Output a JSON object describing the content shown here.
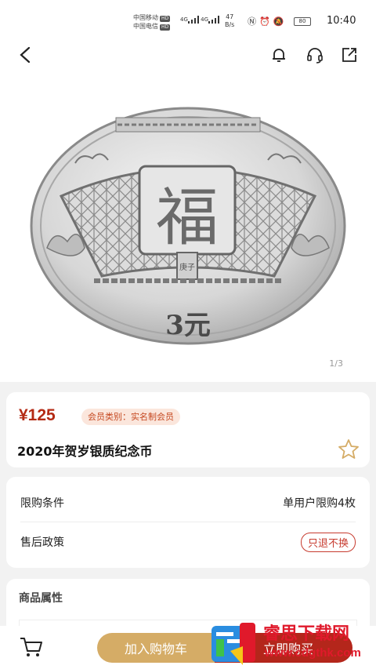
{
  "status_bar": {
    "carrier1": "中国移动",
    "carrier2": "中国电信",
    "hd": "HD",
    "net": "4G",
    "speed_value": "47",
    "speed_unit": "B/s",
    "battery": "80",
    "time": "10:40"
  },
  "nav": {
    "back_icon": "chevron-left-icon",
    "bell_icon": "bell-icon",
    "service_icon": "headset-icon",
    "share_icon": "share-icon"
  },
  "hero": {
    "coin_center": "福",
    "coin_seal": "庚子",
    "coin_value": "3元",
    "image_counter": "1/3"
  },
  "product": {
    "price": "¥125",
    "member_badge": "会员类别：实名制会员",
    "title": "2020年贺岁银质纪念币"
  },
  "policy": {
    "limit_label": "限购条件",
    "limit_value": "单用户限购4枚",
    "aftersale_label": "售后政策",
    "aftersale_value": "只退不换"
  },
  "attributes": {
    "title": "商品属性"
  },
  "bottom_bar": {
    "add_to_cart": "加入购物车",
    "buy_now": "立即购买"
  },
  "watermark": {
    "text": "睿思下载网",
    "url": "www.cdgthk.com"
  },
  "colors": {
    "price_red": "#b42a14",
    "gold": "#d5ac66",
    "buy_red": "#b4261b"
  }
}
